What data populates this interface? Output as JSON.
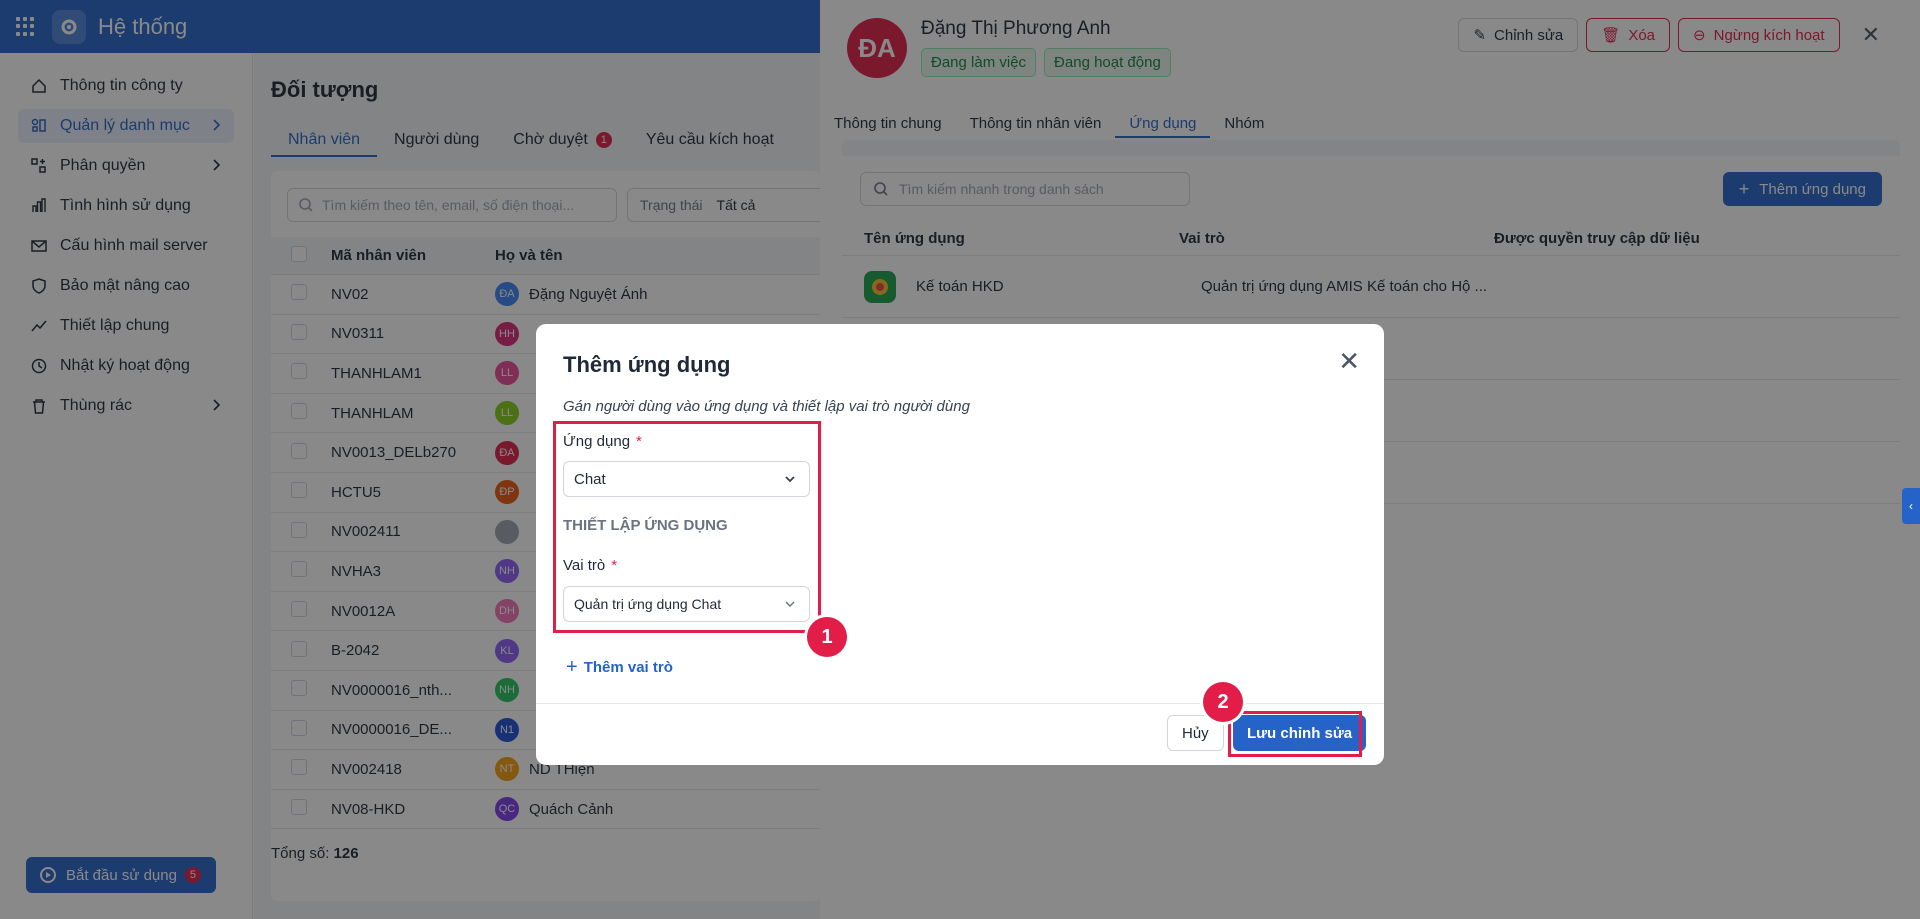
{
  "app": {
    "title": "Hệ thống"
  },
  "sidebar": {
    "items": [
      {
        "label": "Thông tin công ty",
        "icon": "home-icon"
      },
      {
        "label": "Quản lý danh mục",
        "icon": "catalog-icon",
        "active": true,
        "expandable": true
      },
      {
        "label": "Phân quyền",
        "icon": "permission-icon",
        "expandable": true
      },
      {
        "label": "Tình hình sử dụng",
        "icon": "chart-icon"
      },
      {
        "label": "Cấu hình mail server",
        "icon": "mail-icon"
      },
      {
        "label": "Bảo mật nâng cao",
        "icon": "shield-icon"
      },
      {
        "label": "Thiết lập chung",
        "icon": "trend-icon"
      },
      {
        "label": "Nhật ký hoạt động",
        "icon": "history-icon"
      },
      {
        "label": "Thùng rác",
        "icon": "trash-icon",
        "expandable": true
      }
    ],
    "start_button": {
      "label": "Bắt đầu sử dụng",
      "badge": "5"
    }
  },
  "main": {
    "title": "Đối tượng",
    "tabs": [
      {
        "label": "Nhân viên",
        "active": true
      },
      {
        "label": "Người dùng"
      },
      {
        "label": "Chờ duyệt",
        "badge": "1"
      },
      {
        "label": "Yêu cầu kích hoạt"
      }
    ],
    "search_placeholder": "Tìm kiếm theo tên, email, số điện thoại...",
    "filter": {
      "label": "Trạng thái",
      "value": "Tất cả"
    },
    "columns": [
      "Mã nhân viên",
      "Họ và tên"
    ],
    "rows": [
      {
        "code": "NV02",
        "initials": "ĐA",
        "color": "#3b82f6",
        "name": "Đặng Nguyệt Ánh"
      },
      {
        "code": "NV0311",
        "initials": "HH",
        "color": "#db2777",
        "name": ""
      },
      {
        "code": "THANHLAM1",
        "initials": "LL",
        "color": "#ec4899",
        "name": ""
      },
      {
        "code": "THANHLAM",
        "initials": "LL",
        "color": "#84cc16",
        "name": ""
      },
      {
        "code": "NV0013_DELb270",
        "initials": "ĐA",
        "color": "#e11d48",
        "name": ""
      },
      {
        "code": "HCTU5",
        "initials": "ĐP",
        "color": "#ea580c",
        "name": ""
      },
      {
        "code": "NV002411",
        "initials": "",
        "color": "#9ca3af",
        "name": ""
      },
      {
        "code": "NVHA3",
        "initials": "NH",
        "color": "#8b5cf6",
        "name": ""
      },
      {
        "code": "NV0012A",
        "initials": "DH",
        "color": "#f472b6",
        "name": ""
      },
      {
        "code": "B-2042",
        "initials": "KL",
        "color": "#8b5cf6",
        "name": ""
      },
      {
        "code": "NV0000016_nth...",
        "initials": "NH",
        "color": "#22c55e",
        "name": ""
      },
      {
        "code": "NV0000016_DE...",
        "initials": "N1",
        "color": "#1d4ed8",
        "name": ""
      },
      {
        "code": "NV002418",
        "initials": "NT",
        "color": "#f59e0b",
        "name": "ND THiện"
      },
      {
        "code": "NV08-HKD",
        "initials": "QC",
        "color": "#7c3aed",
        "name": "Quách Cảnh"
      }
    ],
    "total_label": "Tổng số:",
    "total_value": "126"
  },
  "panel": {
    "avatar": "ĐA",
    "name": "Đặng Thị Phương Anh",
    "tags": [
      "Đang làm việc",
      "Đang hoạt động"
    ],
    "buttons": {
      "edit": "Chỉnh sửa",
      "delete": "Xóa",
      "deactivate": "Ngừng kích hoạt"
    },
    "tabs": [
      {
        "label": "Thông tin chung"
      },
      {
        "label": "Thông tin nhân viên"
      },
      {
        "label": "Ứng dụng",
        "active": true
      },
      {
        "label": "Nhóm"
      }
    ],
    "search_placeholder": "Tìm kiếm nhanh trong danh sách",
    "add_app_label": "Thêm ứng dụng",
    "columns": [
      "Tên ứng dụng",
      "Vai trò",
      "Được quyền truy cập dữ liệu"
    ],
    "rows": [
      {
        "app": "Kế toán HKD",
        "role": "Quản trị ứng dụng AMIS Kế toán cho Hộ ..."
      }
    ]
  },
  "modal": {
    "title": "Thêm ứng dụng",
    "subtitle": "Gán người dùng vào ứng dụng và thiết lập vai trò người dùng",
    "app_label": "Ứng dụng",
    "app_value": "Chat",
    "section": "THIẾT LẬP ỨNG DỤNG",
    "role_label": "Vai trò",
    "role_value": "Quản trị ứng dụng Chat",
    "add_role": "Thêm vai trò",
    "cancel": "Hủy",
    "save": "Lưu chỉnh sửa"
  },
  "annotations": {
    "step1": "1",
    "step2": "2",
    "color": "#e11d48"
  }
}
